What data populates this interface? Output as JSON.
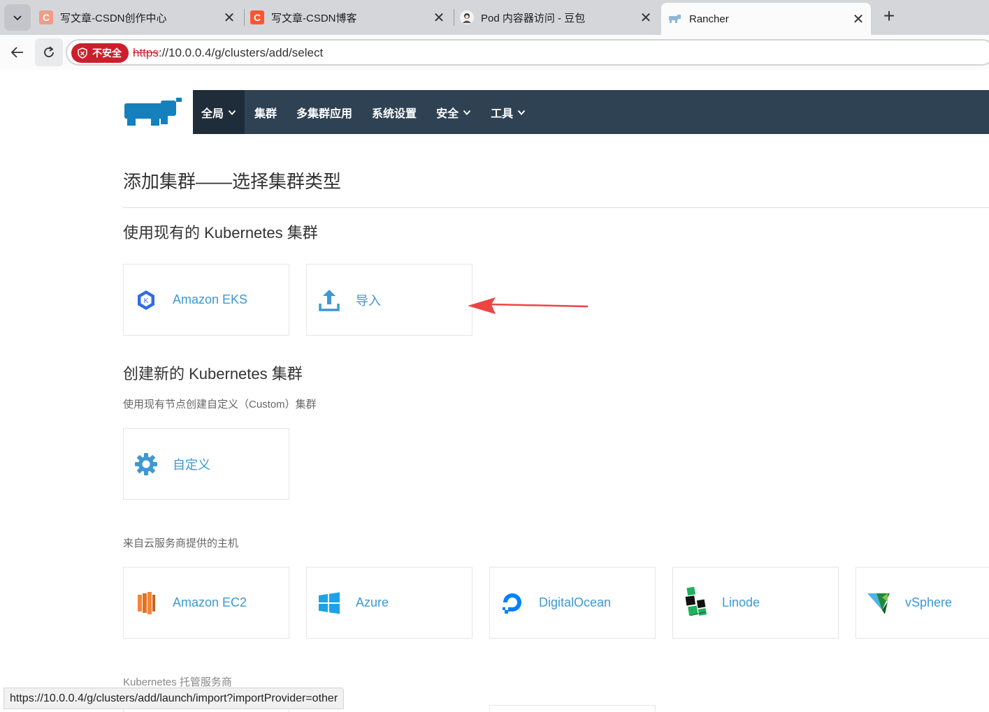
{
  "browser": {
    "tabs": [
      {
        "title": "写文章-CSDN创作中心",
        "favicon": "C",
        "color": "#fc5531"
      },
      {
        "title": "写文章-CSDN博客",
        "favicon": "C",
        "color": "#fc5531"
      },
      {
        "title": "Pod 内容器访问 - 豆包",
        "favicon": "avatar",
        "color": "#4a4a4a"
      },
      {
        "title": "Rancher",
        "favicon": "rancher",
        "color": "#3d98d3"
      }
    ],
    "address": {
      "security_label": "不安全",
      "scheme": "https",
      "rest": "://10.0.0.4/g/clusters/add/select"
    },
    "status_url": "https://10.0.0.4/g/clusters/add/launch/import?importProvider=other"
  },
  "nav": {
    "items": [
      {
        "label": "全局",
        "dropdown": true
      },
      {
        "label": "集群",
        "dropdown": false
      },
      {
        "label": "多集群应用",
        "dropdown": false
      },
      {
        "label": "系统设置",
        "dropdown": false
      },
      {
        "label": "安全",
        "dropdown": true
      },
      {
        "label": "工具",
        "dropdown": true
      }
    ]
  },
  "page": {
    "title": "添加集群——选择集群类型",
    "existing": {
      "heading": "使用现有的 Kubernetes 集群",
      "cards": [
        {
          "label": "Amazon EKS",
          "icon": "eks-icon"
        },
        {
          "label": "导入",
          "icon": "upload-icon"
        }
      ]
    },
    "create": {
      "heading": "创建新的 Kubernetes 集群",
      "custom_sub": "使用现有节点创建自定义（Custom）集群",
      "custom_card": {
        "label": "自定义",
        "icon": "gear-icon"
      },
      "cloud_sub": "来自云服务商提供的主机",
      "cloud_cards": [
        {
          "label": "Amazon EC2",
          "icon": "ec2-icon"
        },
        {
          "label": "Azure",
          "icon": "azure-icon"
        },
        {
          "label": "DigitalOcean",
          "icon": "digitalocean-icon"
        },
        {
          "label": "Linode",
          "icon": "linode-icon"
        },
        {
          "label": "vSphere",
          "icon": "vsphere-icon"
        }
      ],
      "hosted_sub": "Kubernetes 托管服务商"
    }
  },
  "colors": {
    "accent": "#3d98d3",
    "nav_bg": "#2f4254",
    "insecure": "#cc1f2c",
    "annotation": "#ee4444"
  }
}
